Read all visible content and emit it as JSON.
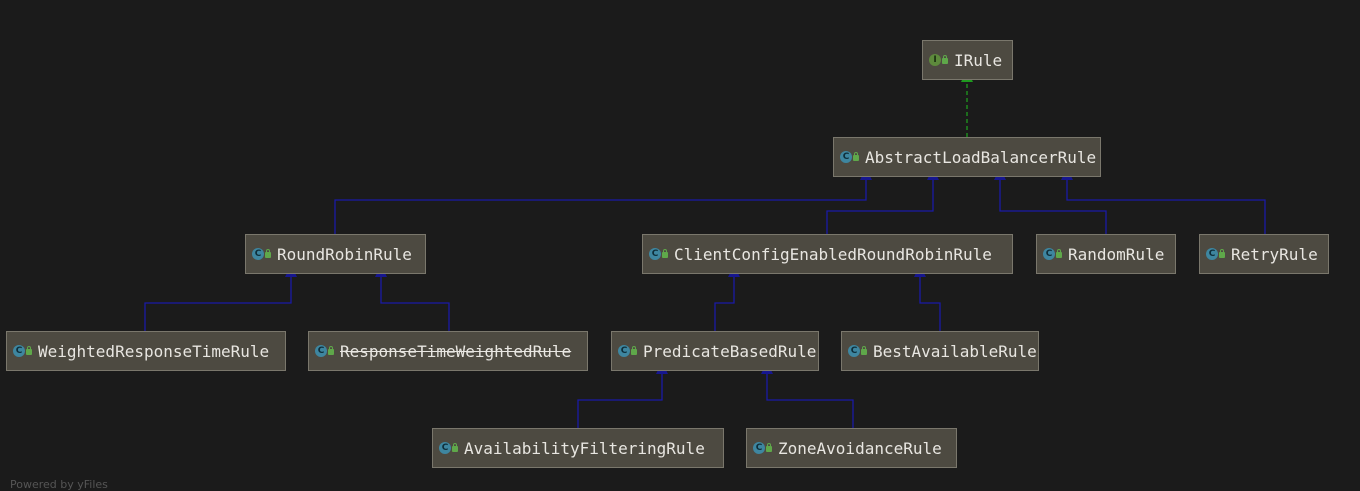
{
  "nodes": {
    "irule": {
      "label": "IRule",
      "kind": "interface"
    },
    "abstract_lb": {
      "label": "AbstractLoadBalancerRule",
      "kind": "abstract-class"
    },
    "round_robin": {
      "label": "RoundRobinRule",
      "kind": "class"
    },
    "client_config": {
      "label": "ClientConfigEnabledRoundRobinRule",
      "kind": "class"
    },
    "random": {
      "label": "RandomRule",
      "kind": "class"
    },
    "retry": {
      "label": "RetryRule",
      "kind": "class"
    },
    "weighted_response": {
      "label": "WeightedResponseTimeRule",
      "kind": "class"
    },
    "response_time_weighted": {
      "label": "ResponseTimeWeightedRule",
      "kind": "class",
      "deprecated": true
    },
    "predicate_based": {
      "label": "PredicateBasedRule",
      "kind": "abstract-class"
    },
    "best_available": {
      "label": "BestAvailableRule",
      "kind": "class"
    },
    "availability_filtering": {
      "label": "AvailabilityFilteringRule",
      "kind": "class"
    },
    "zone_avoidance": {
      "label": "ZoneAvoidanceRule",
      "kind": "class"
    }
  },
  "edges": [
    {
      "from": "abstract_lb",
      "to": "irule",
      "type": "implements"
    },
    {
      "from": "round_robin",
      "to": "abstract_lb",
      "type": "extends"
    },
    {
      "from": "client_config",
      "to": "abstract_lb",
      "type": "extends"
    },
    {
      "from": "random",
      "to": "abstract_lb",
      "type": "extends"
    },
    {
      "from": "retry",
      "to": "abstract_lb",
      "type": "extends"
    },
    {
      "from": "weighted_response",
      "to": "round_robin",
      "type": "extends"
    },
    {
      "from": "response_time_weighted",
      "to": "round_robin",
      "type": "extends"
    },
    {
      "from": "predicate_based",
      "to": "client_config",
      "type": "extends"
    },
    {
      "from": "best_available",
      "to": "client_config",
      "type": "extends"
    },
    {
      "from": "availability_filtering",
      "to": "predicate_based",
      "type": "extends"
    },
    {
      "from": "zone_avoidance",
      "to": "predicate_based",
      "type": "extends"
    }
  ],
  "colors": {
    "background": "#1b1b1b",
    "node_fill": "#4d4a41",
    "extends_edge": "#1a1aa6",
    "implements_edge": "#1f9a1f",
    "class_icon": "#3e86a0",
    "interface_icon": "#5d8a3c"
  },
  "footer": "Powered by yFiles"
}
